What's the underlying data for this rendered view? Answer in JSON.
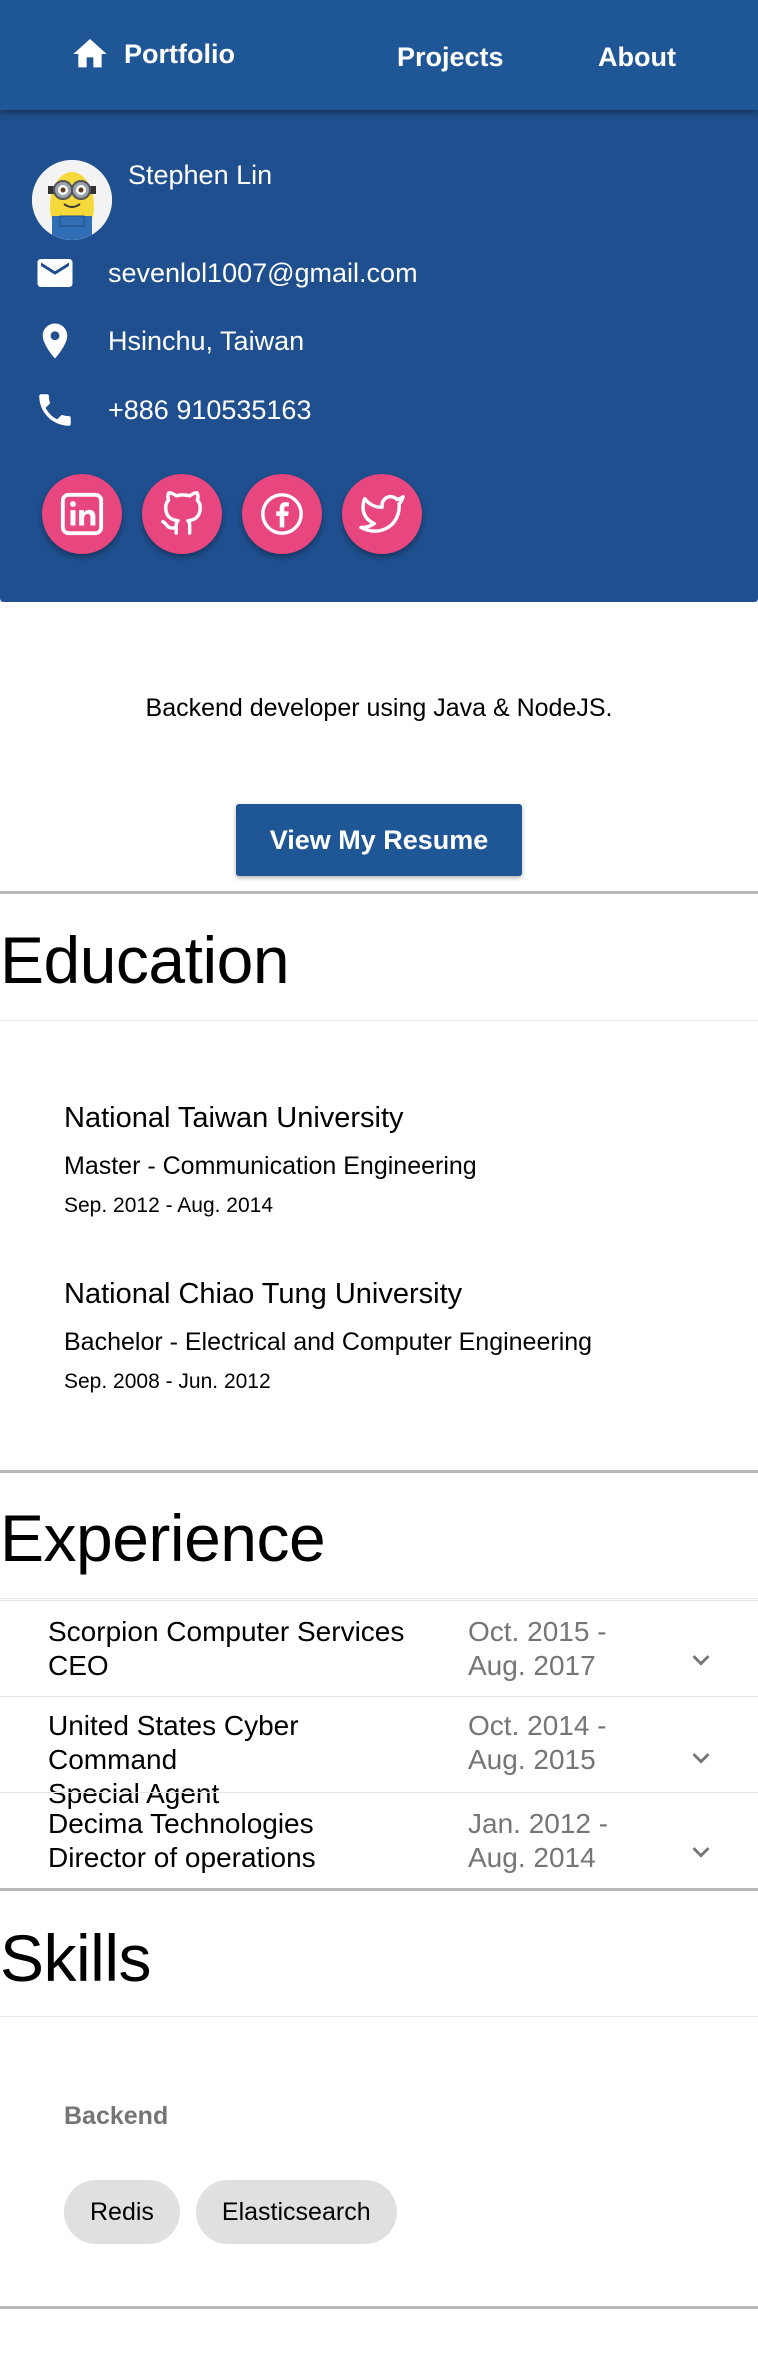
{
  "nav": {
    "brand": "Portfolio",
    "links": [
      "Projects",
      "About"
    ]
  },
  "profile": {
    "name": "Stephen Lin",
    "email": "sevenlol1007@gmail.com",
    "location": "Hsinchu, Taiwan",
    "phone": "+886 910535163",
    "socials": [
      "linkedin-icon",
      "github-icon",
      "facebook-icon",
      "twitter-icon"
    ]
  },
  "intro": {
    "tagline": "Backend developer using Java & NodeJS.",
    "resume_button": "View My Resume"
  },
  "education": {
    "title": "Education",
    "items": [
      {
        "school": "National Taiwan University",
        "degree": "Master - Communication Engineering",
        "dates": "Sep. 2012 - Aug. 2014"
      },
      {
        "school": "National Chiao Tung University",
        "degree": "Bachelor - Electrical and Computer Engineering",
        "dates": "Sep. 2008 - Jun. 2012"
      }
    ]
  },
  "experience": {
    "title": "Experience",
    "items": [
      {
        "company": "Scorpion Computer Services",
        "role": "CEO",
        "dates": "Oct. 2015 - Aug. 2017"
      },
      {
        "company": "United States Cyber Command",
        "role": "Special Agent",
        "dates": "Oct. 2014 - Aug. 2015"
      },
      {
        "company": "Decima Technologies",
        "role": "Director of operations",
        "dates": "Jan. 2012 - Aug. 2014"
      }
    ]
  },
  "skills": {
    "title": "Skills",
    "category": "Backend",
    "chips": [
      "Redis",
      "Elasticsearch"
    ]
  },
  "colors": {
    "appbar": "#1f5696",
    "profile_bg": "#1f4f8e",
    "social_accent": "#e8467f",
    "chip_bg": "#e0e0e0",
    "muted_text": "#757575"
  }
}
